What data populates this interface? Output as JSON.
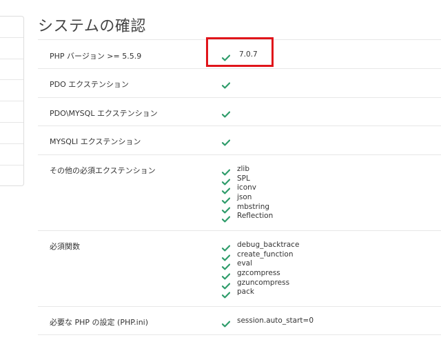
{
  "page": {
    "title": "システムの確認"
  },
  "checks": [
    {
      "label": "PHP バージョン >= 5.5.9",
      "values": [
        "7.0.7"
      ]
    },
    {
      "label": "PDO エクステンション",
      "values": [
        ""
      ]
    },
    {
      "label": "PDO\\MYSQL エクステンション",
      "values": [
        ""
      ]
    },
    {
      "label": "MYSQLI エクステンション",
      "values": [
        ""
      ]
    },
    {
      "label": "その他の必須エクステンション",
      "values": [
        "zlib",
        "SPL",
        "iconv",
        "json",
        "mbstring",
        "Reflection"
      ]
    },
    {
      "label": "必須関数",
      "values": [
        "debug_backtrace",
        "create_function",
        "eval",
        "gzcompress",
        "gzuncompress",
        "pack"
      ]
    },
    {
      "label": "必要な PHP の設定 (PHP.ini)",
      "values": [
        "session.auto_start=0"
      ]
    }
  ],
  "icons": {
    "check": "check-icon"
  },
  "colors": {
    "check": "#2e9c6a",
    "highlight": "#e0141a"
  }
}
